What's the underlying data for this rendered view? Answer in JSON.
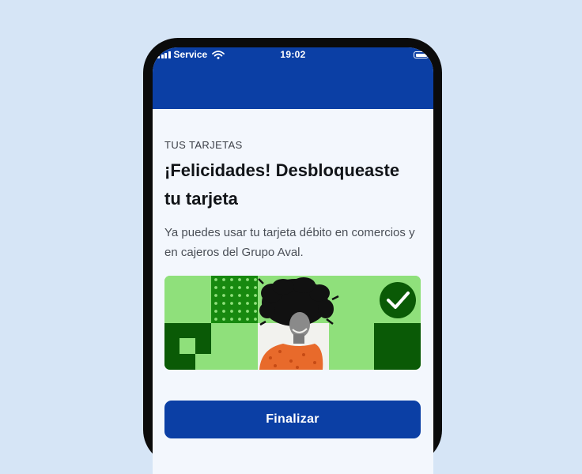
{
  "status_bar": {
    "carrier": "Service",
    "time": "19:02"
  },
  "card": {
    "eyebrow": "TUS TARJETAS",
    "title": "¡Felicidades! Desbloqueaste tu tarjeta",
    "description": "Ya puedes usar tu tarjeta débito en comercios y en cajeros del Grupo Aval."
  },
  "banner": {
    "image": "woman-with-curly-hair-smiling",
    "badge_icon": "check-icon"
  },
  "actions": {
    "finish_label": "Finalizar"
  },
  "colors": {
    "brand_blue": "#0b3fa5",
    "light_green": "#8fe07b",
    "dark_green": "#0a5a06",
    "mid_green": "#17890f",
    "background": "#d6e5f6"
  }
}
